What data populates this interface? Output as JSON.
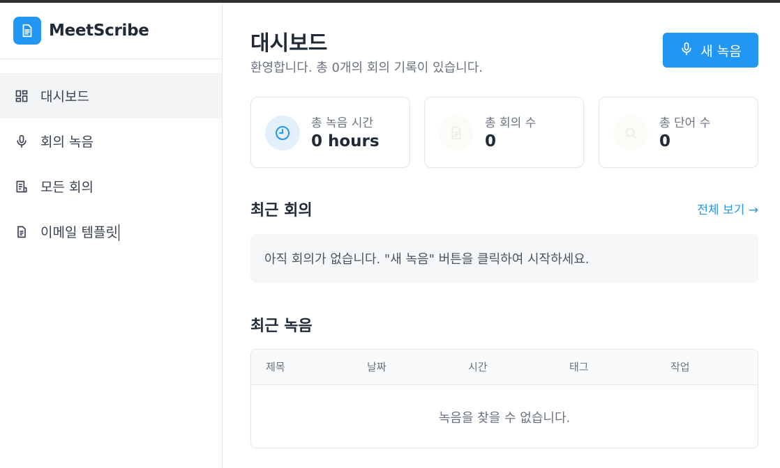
{
  "brand": {
    "name": "MeetScribe",
    "logo_icon": "document-icon",
    "accent": "#2196f3"
  },
  "sidebar": {
    "items": [
      {
        "label": "대시보드",
        "icon": "dashboard-icon",
        "active": true
      },
      {
        "label": "회의 녹음",
        "icon": "microphone-icon",
        "active": false
      },
      {
        "label": "모든 회의",
        "icon": "document-list-icon",
        "active": false
      },
      {
        "label": "이메일 템플릿",
        "icon": "document-icon",
        "active": false
      }
    ]
  },
  "header": {
    "title": "대시보드",
    "subtitle": "환영합니다. 총 0개의 회의 기록이 있습니다.",
    "new_recording_label": "새 녹음"
  },
  "stats": [
    {
      "label": "총 녹음 시간",
      "value": "0 hours",
      "icon": "clock-icon"
    },
    {
      "label": "총 회의 수",
      "value": "0",
      "icon": "document-icon"
    },
    {
      "label": "총 단어 수",
      "value": "0",
      "icon": "search-icon"
    }
  ],
  "recent_meetings": {
    "title": "최근 회의",
    "view_all_label": "전체 보기 →",
    "empty_text": "아직 회의가 없습니다. \"새 녹음\" 버튼을 클릭하여 시작하세요."
  },
  "recent_recordings": {
    "title": "최근 녹음",
    "columns": [
      "제목",
      "날짜",
      "시간",
      "태그",
      "작업"
    ],
    "empty_text": "녹음을 찾을 수 없습니다."
  }
}
